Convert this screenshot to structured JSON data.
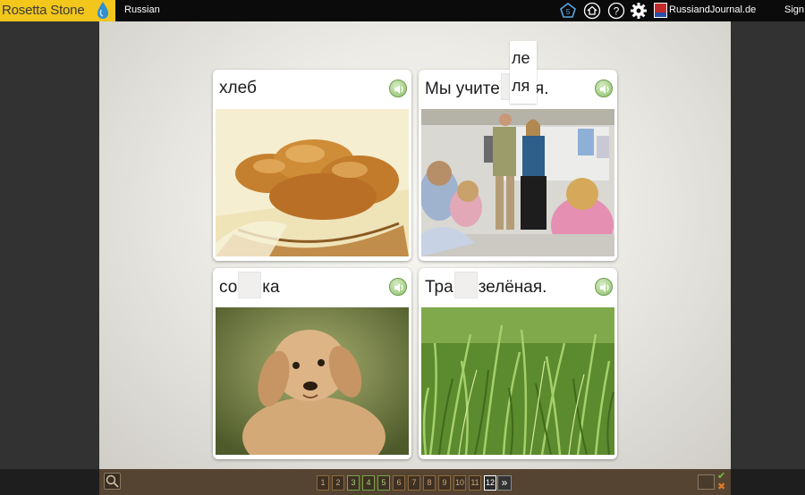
{
  "topbar": {
    "logo_text": "Rosetta Stone",
    "language": "Russian",
    "site_label": "RussiandJournal.de",
    "sign_label": "Sign",
    "icons": [
      "lesson-pentagon-icon",
      "home-icon",
      "help-icon",
      "gear-icon"
    ]
  },
  "cards": [
    {
      "text_before": "хлеб",
      "text_after": "",
      "image": "bread"
    },
    {
      "text_before": "Мы учите",
      "text_after": "ля.",
      "image": "classroom-teachers"
    },
    {
      "text_before": "со",
      "text_after": "ка",
      "image": "dog"
    },
    {
      "text_before": "Тра",
      "text_after": "зелёная.",
      "image": "grass"
    }
  ],
  "tile": {
    "top": "ле",
    "bottom": "ля"
  },
  "pager": {
    "pages": [
      "1",
      "2",
      "3",
      "4",
      "5",
      "6",
      "7",
      "8",
      "9",
      "10",
      "11",
      "12"
    ],
    "done_pages": [
      "3",
      "4",
      "5"
    ],
    "current_page": "12",
    "next_label": "»"
  },
  "colors": {
    "logo_yellow": "#f3c61c",
    "topbar": "#0b0b0b",
    "bottom_strip": "#554431",
    "speaker_green": "#8cbf68"
  }
}
